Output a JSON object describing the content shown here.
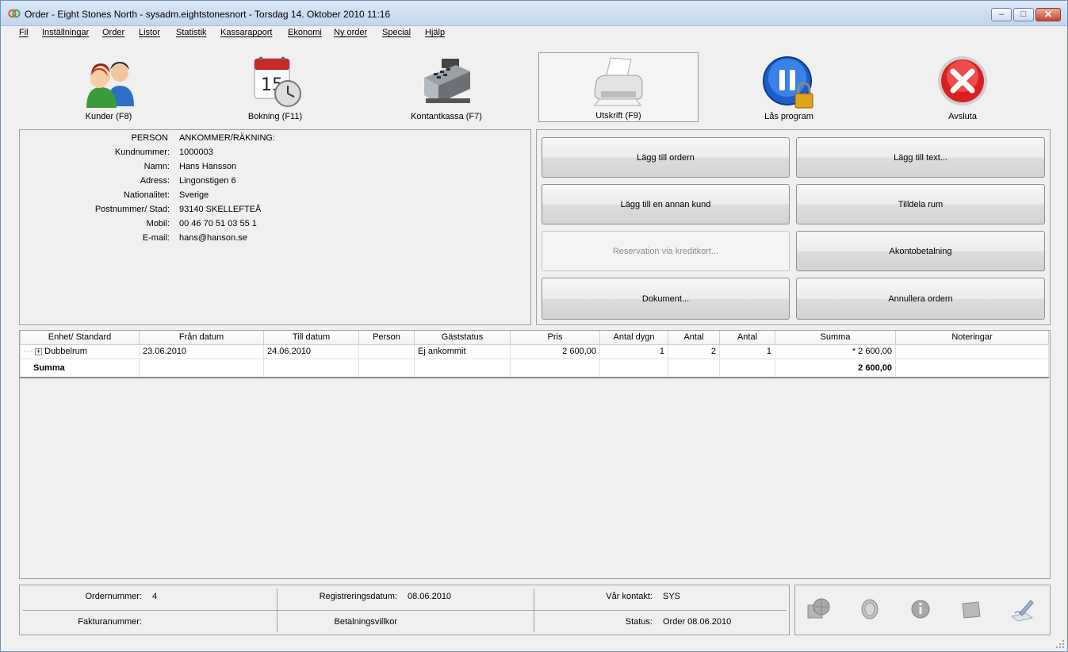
{
  "window": {
    "title": "Order - Eight Stones North - sysadm.eightstonesnort - Torsdag 14. Oktober 2010 11:16",
    "buttons": {
      "minimize": "–",
      "maximize": "□",
      "close": "✕"
    }
  },
  "menu": [
    "Fil",
    "Inställningar",
    "Order",
    "Listor",
    "Statistik",
    "Kassarapport",
    "Ekonomi",
    "Ny order",
    "Special",
    "Hjälp"
  ],
  "toolbar": [
    {
      "label": "Kunder (F8)",
      "icon": "customers-icon"
    },
    {
      "label": "Bokning (F11)",
      "icon": "calendar-clock-icon"
    },
    {
      "label": "Kontantkassa (F7)",
      "icon": "cash-register-icon"
    },
    {
      "label": "Utskrift (F9)",
      "icon": "printer-icon"
    },
    {
      "label": "Lås program",
      "icon": "pause-lock-icon"
    },
    {
      "label": "Avsluta",
      "icon": "exit-icon"
    }
  ],
  "customer": {
    "header_left": "PERSON",
    "header_right": "ANKOMMER/RÄKNING:",
    "fields": [
      {
        "label": "Kundnummer:",
        "value": "1000003"
      },
      {
        "label": "Namn:",
        "value": "Hans Hansson"
      },
      {
        "label": "Adress:",
        "value": "Lingonstigen 6"
      },
      {
        "label": "Nationalitet:",
        "value": "Sverige"
      },
      {
        "label": "Postnummer/ Stad:",
        "value": "93140 SKELLEFTEÅ"
      },
      {
        "label": "Mobil:",
        "value": "00 46 70 51 03 55 1"
      },
      {
        "label": "E-mail:",
        "value": "hans@hanson.se"
      }
    ]
  },
  "actions": {
    "add_to_order": "Lägg till ordern",
    "add_text": "Lägg till text...",
    "add_other_customer": "Lägg till en annan kund",
    "assign_room": "Tilldela rum",
    "reservation_cc": "Reservation via kreditkort...",
    "deposit": "Akontobetalning",
    "documents": "Dokument...",
    "cancel_order": "Annullera ordern"
  },
  "grid": {
    "columns": [
      "Enhet/ Standard",
      "Från datum",
      "Till datum",
      "Person",
      "Gäststatus",
      "Pris",
      "Antal dygn",
      "Antal",
      "Antal",
      "Summa",
      "Noteringar"
    ],
    "rows": [
      {
        "unit": "Dubbelrum",
        "from": "23.06.2010",
        "to": "24.06.2010",
        "person": "",
        "status": "Ej ankommit",
        "price": "2 600,00",
        "nights": "1",
        "qty1": "2",
        "qty2": "1",
        "sum": "* 2 600,00",
        "notes": ""
      }
    ],
    "summary": {
      "label": "Summa",
      "sum": "2 600,00"
    }
  },
  "footer": {
    "order_no_label": "Ordernummer:",
    "order_no": "4",
    "reg_date_label": "Registreringsdatum:",
    "reg_date": "08.06.2010",
    "contact_label": "Vår kontakt:",
    "contact": "SYS",
    "invoice_no_label": "Fakturanummer:",
    "payment_terms_label": "Betalningsvillkor",
    "status_label": "Status:",
    "status": "Order 08.06.2010"
  }
}
